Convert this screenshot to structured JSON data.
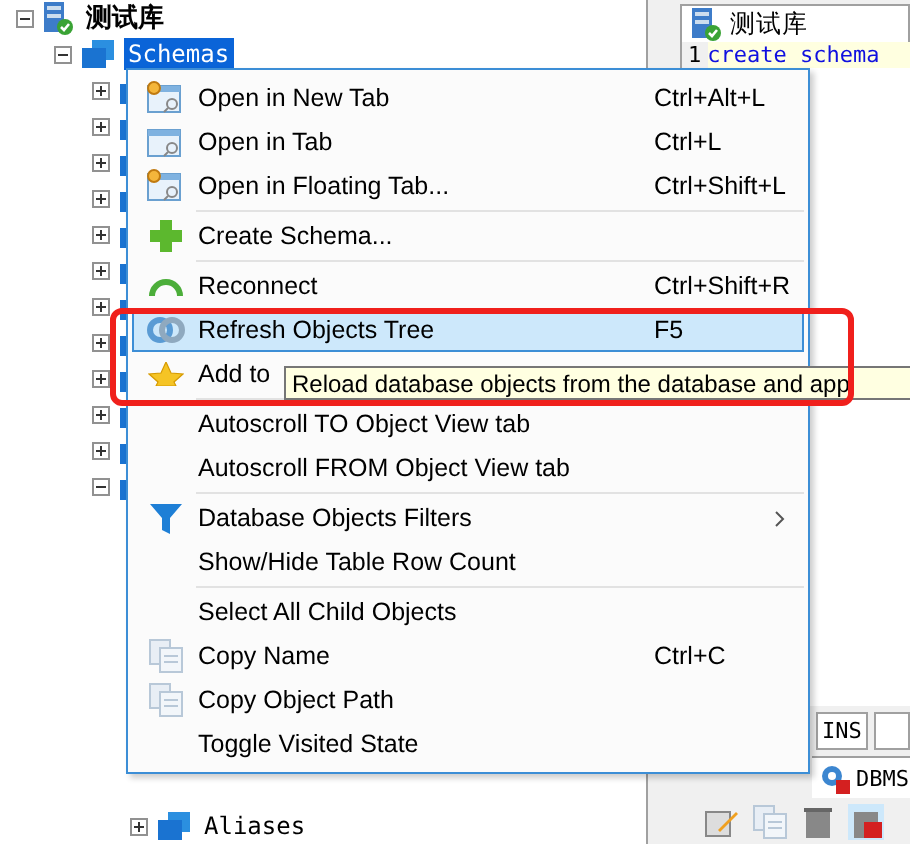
{
  "tree": {
    "label": "测试库",
    "expanded": true,
    "children": [
      {
        "label": "Schemas",
        "expanded": true,
        "selected": true,
        "children": [
          {
            "expanded": false
          },
          {
            "expanded": false
          },
          {
            "expanded": false
          },
          {
            "expanded": false
          },
          {
            "expanded": false
          },
          {
            "expanded": false
          },
          {
            "expanded": false
          },
          {
            "expanded": false
          },
          {
            "expanded": false
          },
          {
            "expanded": false
          },
          {
            "expanded": false
          },
          {
            "expanded": true,
            "children": [
              {
                "label": "Aliases",
                "expanded": false
              }
            ]
          }
        ]
      }
    ]
  },
  "editor": {
    "tab": "测试库",
    "line_number": "1",
    "code": "create schema"
  },
  "status_bar": {
    "mode": "INS"
  },
  "lower_panel": {
    "tab": "DBMS"
  },
  "context_menu": {
    "items": [
      {
        "kind": "item",
        "label": "Open in New Tab",
        "shortcut": "Ctrl+Alt+L",
        "selected": false,
        "submenu": false
      },
      {
        "kind": "item",
        "label": "Open in Tab",
        "shortcut": "Ctrl+L",
        "selected": false,
        "submenu": false
      },
      {
        "kind": "item",
        "label": "Open in Floating Tab...",
        "shortcut": "Ctrl+Shift+L",
        "selected": false,
        "submenu": false
      },
      {
        "kind": "separator"
      },
      {
        "kind": "item",
        "label": "Create Schema...",
        "selected": false,
        "submenu": false
      },
      {
        "kind": "separator"
      },
      {
        "kind": "item",
        "label": "Reconnect",
        "shortcut": "Ctrl+Shift+R",
        "selected": false,
        "submenu": false
      },
      {
        "kind": "item",
        "label": "Refresh Objects Tree",
        "shortcut": "F5",
        "selected": true,
        "submenu": false
      },
      {
        "kind": "item",
        "label": "Add to",
        "selected": false,
        "submenu": false
      },
      {
        "kind": "separator"
      },
      {
        "kind": "item",
        "label": "Autoscroll TO Object View tab",
        "selected": false,
        "submenu": false
      },
      {
        "kind": "item",
        "label": "Autoscroll FROM Object View tab",
        "selected": false,
        "submenu": false
      },
      {
        "kind": "separator"
      },
      {
        "kind": "item",
        "label": "Database Objects Filters",
        "selected": false,
        "submenu": true
      },
      {
        "kind": "item",
        "label": "Show/Hide Table Row Count",
        "selected": false,
        "submenu": false
      },
      {
        "kind": "separator"
      },
      {
        "kind": "item",
        "label": "Select All Child Objects",
        "selected": false,
        "submenu": false
      },
      {
        "kind": "item",
        "label": "Copy Name",
        "shortcut": "Ctrl+C",
        "selected": false,
        "submenu": false
      },
      {
        "kind": "item",
        "label": "Copy Object Path",
        "selected": false,
        "submenu": false
      },
      {
        "kind": "item",
        "label": "Toggle Visited State",
        "selected": false,
        "submenu": false
      }
    ]
  },
  "tooltip": {
    "text": "Reload database objects from the database and app"
  }
}
